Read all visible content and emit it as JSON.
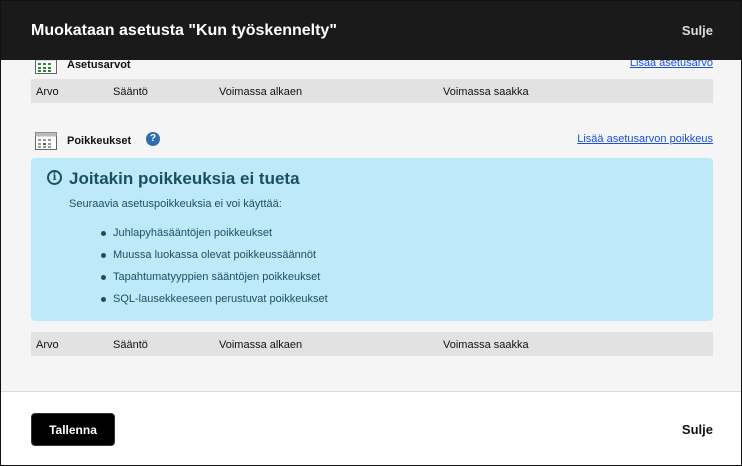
{
  "dialog": {
    "title": "Muokataan asetusta \"Kun työskennelty\"",
    "close_label": "Sulje"
  },
  "setting_values": {
    "title": "Asetusarvot",
    "icon": "calendar-grid-icon",
    "add_link": "Lisää asetusarvo",
    "columns": [
      "Arvo",
      "Sääntö",
      "Voimassa alkaen",
      "Voimassa saakka"
    ]
  },
  "exceptions": {
    "title": "Poikkeukset",
    "icon": "calendar-grid-icon",
    "help_icon": "?",
    "add_link": "Lisää asetusarvon poikkeus",
    "columns": [
      "Arvo",
      "Sääntö",
      "Voimassa alkaen",
      "Voimassa saakka"
    ]
  },
  "notice": {
    "icon": "i",
    "title": "Joitakin poikkeuksia ei tueta",
    "text": "Seuraavia asetuspoikkeuksia ei voi käyttää:",
    "items": [
      "Juhlapyhäsääntöjen poikkeukset",
      "Muussa luokassa olevat poikkeussäännöt",
      "Tapahtumatyyppien sääntöjen poikkeukset",
      "SQL-lausekkeeseen perustuvat poikkeukset"
    ]
  },
  "footer": {
    "save_label": "Tallenna",
    "close_label": "Sulje"
  },
  "colors": {
    "header_bg": "#1a1a1a",
    "notice_bg": "#bde9f9",
    "link": "#1a4fd6",
    "table_head_bg": "#e2e2e2"
  }
}
